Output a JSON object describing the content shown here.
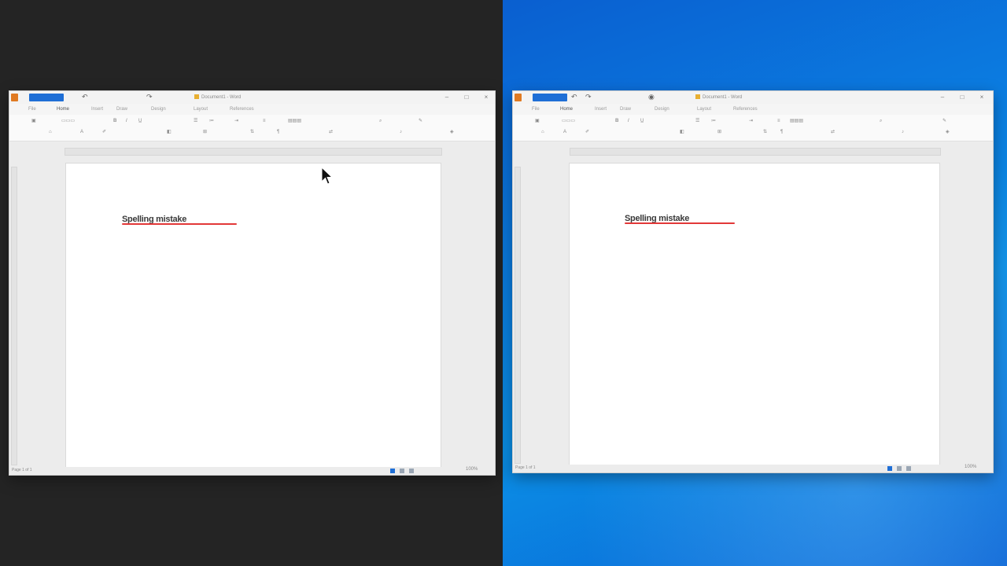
{
  "windows": [
    {
      "id": "left",
      "title_bar": {
        "document_title": "Document1 - Word",
        "window_controls": [
          "–",
          "□",
          "×"
        ]
      },
      "ribbon_tabs": [
        "File",
        "Home",
        "Insert",
        "Draw",
        "Design",
        "Layout",
        "References"
      ],
      "document": {
        "text": "Spelling mistake",
        "spellcheck_flag": true
      },
      "status_bar": {
        "left": "Page 1 of 1",
        "zoom": "100%"
      },
      "has_cursor": true
    },
    {
      "id": "right",
      "title_bar": {
        "document_title": "Document1 - Word",
        "window_controls": [
          "–",
          "□",
          "×"
        ]
      },
      "ribbon_tabs": [
        "File",
        "Home",
        "Insert",
        "Draw",
        "Design",
        "Layout",
        "References"
      ],
      "document": {
        "text": "Spelling mistake",
        "spellcheck_flag": true
      },
      "status_bar": {
        "left": "Page 1 of 1",
        "zoom": "100%"
      },
      "has_cursor": false
    }
  ],
  "icons": {
    "cursor": "mouse-pointer-icon",
    "app": "word-app-icon"
  },
  "colors": {
    "desktop_left": "#242424",
    "desktop_right": "#0b7be0",
    "spell_underline": "#e23838",
    "accent": "#1f6fd6"
  }
}
